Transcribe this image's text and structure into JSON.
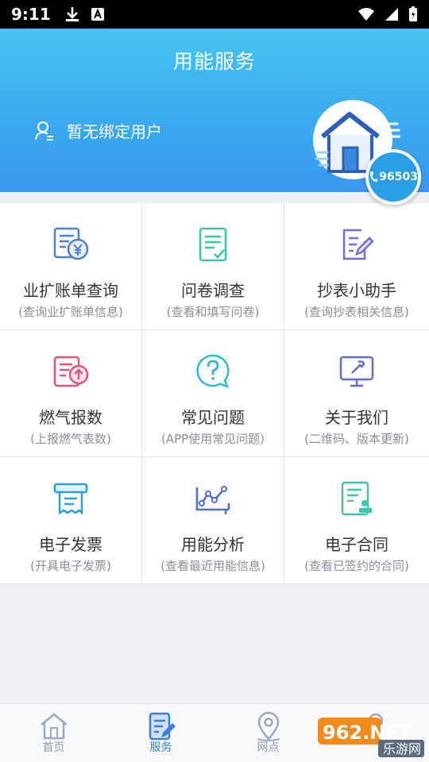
{
  "status_bar": {
    "time": "9:11"
  },
  "header": {
    "title": "用能服务",
    "user_status": "暂无绑定用户",
    "hotline": "96503"
  },
  "services": [
    {
      "title": "业扩账单查询",
      "subtitle": "(查询业扩账单信息)",
      "icon": "bill-yen-icon",
      "color": "#4a7fd6"
    },
    {
      "title": "问卷调查",
      "subtitle": "(查看和填写问卷)",
      "icon": "questionnaire-icon",
      "color": "#3cc5a8"
    },
    {
      "title": "抄表小助手",
      "subtitle": "(查询抄表相关信息)",
      "icon": "meter-edit-icon",
      "color": "#6d6fd6"
    },
    {
      "title": "燃气报数",
      "subtitle": "(上报燃气表数)",
      "icon": "gas-report-icon",
      "color": "#e0557a"
    },
    {
      "title": "常见问题",
      "subtitle": "(APP使用常见问题)",
      "icon": "faq-icon",
      "color": "#2db8d8"
    },
    {
      "title": "关于我们",
      "subtitle": "(二维码、版本更新)",
      "icon": "about-monitor-icon",
      "color": "#5a6fd6"
    },
    {
      "title": "电子发票",
      "subtitle": "(开具电子发票)",
      "icon": "invoice-icon",
      "color": "#2a9fd6"
    },
    {
      "title": "用能分析",
      "subtitle": "(查看最近用能信息)",
      "icon": "analysis-chart-icon",
      "color": "#4a6fd6"
    },
    {
      "title": "电子合同",
      "subtitle": "(查看已签约的合同)",
      "icon": "contract-icon",
      "color": "#3cc5a8"
    }
  ],
  "tabs": [
    {
      "label": "首页",
      "icon": "home-icon",
      "active": false
    },
    {
      "label": "服务",
      "icon": "service-icon",
      "active": true
    },
    {
      "label": "网点",
      "icon": "location-icon",
      "active": false
    },
    {
      "label": "",
      "icon": "profile-icon",
      "active": false
    }
  ],
  "watermark": {
    "logo": "962.NET",
    "text": "乐游网"
  }
}
